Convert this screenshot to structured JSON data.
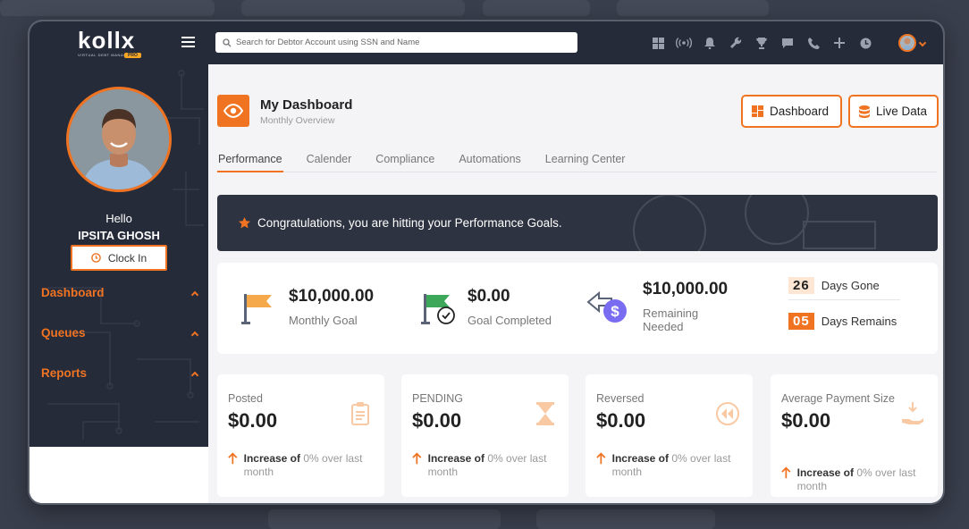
{
  "app": {
    "logo_text": "kollx",
    "logo_subtitle": "VIRTUAL DEBT MANAGEMENT",
    "logo_badge": "PRO"
  },
  "search": {
    "placeholder": "Search for Debtor Account using SSN and Name"
  },
  "topbar_icons": [
    "grid-icon",
    "broadcast-icon",
    "bell-icon",
    "wrench-icon",
    "trophy-icon",
    "chat-icon",
    "phone-icon",
    "plus-icon",
    "clock-icon"
  ],
  "sidebar": {
    "greeting": "Hello",
    "user_name": "IPSITA GHOSH",
    "clock_in_label": "Clock In",
    "items": [
      {
        "label": "Dashboard"
      },
      {
        "label": "Queues"
      },
      {
        "label": "Reports"
      }
    ]
  },
  "page": {
    "title": "My Dashboard",
    "subtitle": "Monthly Overview",
    "dashboard_button": "Dashboard",
    "live_data_button": "Live Data"
  },
  "tabs": [
    {
      "label": "Performance",
      "active": true
    },
    {
      "label": "Calender"
    },
    {
      "label": "Compliance"
    },
    {
      "label": "Automations"
    },
    {
      "label": "Learning Center"
    }
  ],
  "banner": {
    "text": "Congratulations, you are hitting your Performance Goals."
  },
  "goals": {
    "monthly": {
      "value": "$10,000.00",
      "label": "Monthly Goal"
    },
    "completed": {
      "value": "$0.00",
      "label": "Goal Completed"
    },
    "remaining": {
      "value": "$10,000.00",
      "label": "Remaining Needed"
    },
    "days_gone": {
      "value": "26",
      "label": "Days Gone"
    },
    "days_remains": {
      "value": "05",
      "label": "Days Remains"
    }
  },
  "cards": [
    {
      "label": "Posted",
      "value": "$0.00",
      "trend_bold": "Increase of",
      "trend_pct": "0%",
      "trend_rest": "over last month"
    },
    {
      "label": "PENDING",
      "value": "$0.00",
      "trend_bold": "Increase of",
      "trend_pct": "0%",
      "trend_rest": "over last month"
    },
    {
      "label": "Reversed",
      "value": "$0.00",
      "trend_bold": "Increase of",
      "trend_pct": "0%",
      "trend_rest": "over last month"
    },
    {
      "label": "Average Payment Size",
      "value": "$0.00",
      "trend_bold": "Increase of",
      "trend_pct": "0%",
      "trend_rest": "over last month"
    }
  ],
  "colors": {
    "accent": "#f07322",
    "dark": "#262b3a",
    "days_gone_bg": "#fde6d3",
    "days_remains_bg": "#f07322"
  }
}
